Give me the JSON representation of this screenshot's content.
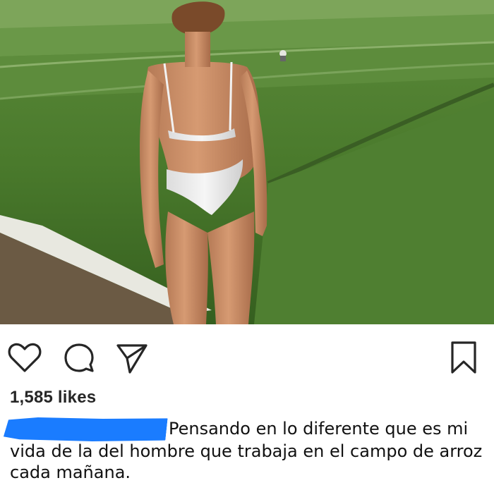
{
  "post": {
    "photo": {
      "description_icon": "photo"
    },
    "actions": {
      "like_icon": "heart-outline",
      "comment_icon": "speech-bubble-outline",
      "share_icon": "paper-plane-outline",
      "save_icon": "bookmark-outline"
    },
    "likes_text": "1,585 likes",
    "caption": {
      "line1": "Pensando en lo diferente que es mi",
      "line2": "vida de la del hombre que trabaja en el campo de arroz",
      "line3": "cada mañana."
    },
    "colors": {
      "redaction": "#1a7cff",
      "icon_stroke": "#262626"
    }
  }
}
